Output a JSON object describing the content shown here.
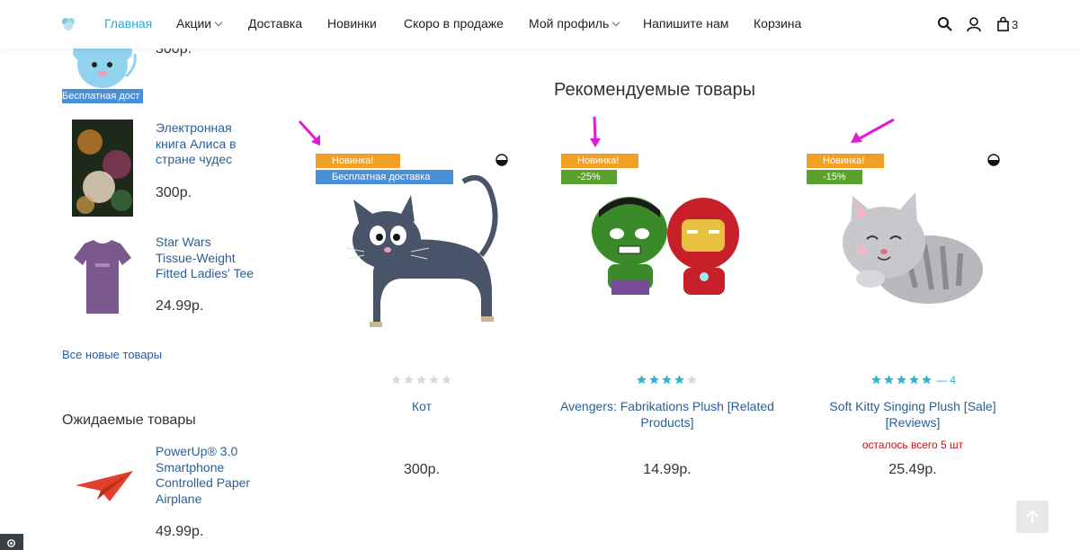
{
  "header": {
    "nav": [
      {
        "label": "Главная",
        "active": true
      },
      {
        "label": "Акции",
        "dropdown": true
      },
      {
        "label": "Доставка"
      },
      {
        "label": "Новинки"
      },
      {
        "label": "Скоро в продаже"
      },
      {
        "label": "Мой профиль",
        "dropdown": true
      },
      {
        "label": "Напишите нам"
      },
      {
        "label": "Корзина"
      }
    ],
    "cart_count": "3",
    "accent_color": "#29aad8"
  },
  "sidebar": {
    "top_item": {
      "price": "300р.",
      "badge": "Бесплатная дост"
    },
    "new_items": [
      {
        "title": "Электронная книга Алиса в стране чудес",
        "price": "300р."
      },
      {
        "title": "Star Wars Tissue-Weight Fitted Ladies' Tee",
        "price": "24.99р."
      }
    ],
    "all_new_link": "Все новые товары",
    "upcoming_title": "Ожидаемые товары",
    "upcoming_items": [
      {
        "title": "PowerUp® 3.0 Smartphone Controlled Paper Airplane",
        "price": "49.99р."
      }
    ]
  },
  "featured": {
    "title": "Рекомендуемые товары",
    "products": [
      {
        "name": "Кот",
        "price": "300р.",
        "badges": [
          "Новинка!",
          "Бесплатная доставка"
        ],
        "rating": 0,
        "reviews": "",
        "stock_note": ""
      },
      {
        "name": "Avengers: Fabrikations Plush [Related Products]",
        "price": "14.99р.",
        "badges": [
          "Новинка!",
          "-25%"
        ],
        "rating": 4,
        "reviews": "",
        "stock_note": ""
      },
      {
        "name": "Soft Kitty Singing Plush [Sale] [Reviews]",
        "price": "25.49р.",
        "badges": [
          "Новинка!",
          "-15%"
        ],
        "rating": 5,
        "reviews": "— 4",
        "stock_note": "осталось всего 5 шт"
      }
    ]
  },
  "icons": [
    "search-icon",
    "user-icon",
    "cart-icon",
    "compare-icon",
    "gear-icon",
    "scroll-top-icon"
  ]
}
